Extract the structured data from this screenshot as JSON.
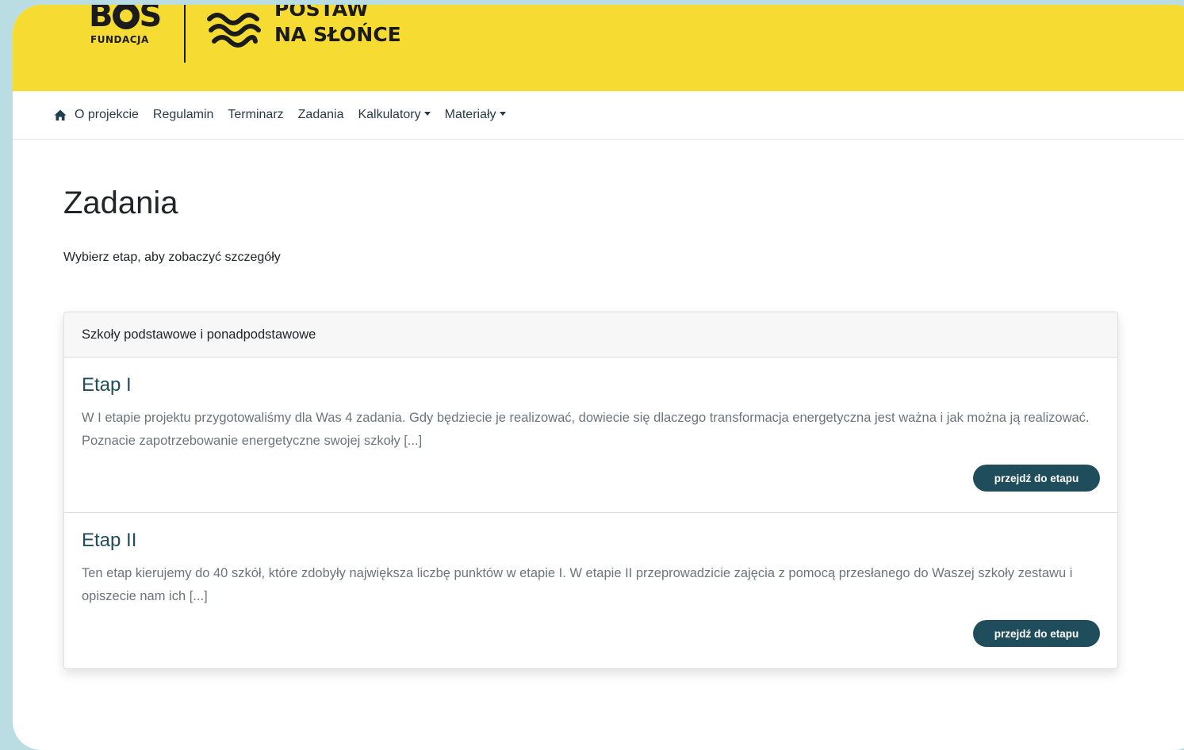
{
  "header": {
    "bos_logo": "B S",
    "bos_logo_sub": "FUNDACJA",
    "project_logo_line1": "POSTAW",
    "project_logo_line2": "NA SŁOŃCE",
    "background_color": "#f6dc32"
  },
  "nav": {
    "home_icon": "home-icon",
    "items": [
      {
        "label": "O projekcie"
      },
      {
        "label": "Regulamin"
      },
      {
        "label": "Terminarz"
      },
      {
        "label": "Zadania"
      },
      {
        "label": "Kalkulatory",
        "dropdown": true
      },
      {
        "label": "Materiały",
        "dropdown": true
      }
    ]
  },
  "page": {
    "title": "Zadania",
    "subtitle": "Wybierz etap, aby zobaczyć szczegóły"
  },
  "card": {
    "header": "Szkoły podstawowe i ponadpodstawowe",
    "stages": [
      {
        "title": "Etap I",
        "description": "W I etapie projektu przygotowaliśmy dla Was 4 zadania. Gdy będziecie je realizować, dowiecie się dlaczego transformacja energetyczna jest ważna i jak można ją realizować. Poznacie zapotrzebowanie energetyczne swojej szkoły [...]",
        "button": "przejdź do etapu"
      },
      {
        "title": "Etap II",
        "description": "Ten etap kierujemy do 40 szkół, które zdobyły największa liczbę punktów w etapie I. W etapie II przeprowadzicie zajęcia z pomocą przesłanego do Waszej szkoły zestawu i opiszecie nam ich [...]",
        "button": "przejdź do etapu"
      }
    ]
  },
  "colors": {
    "accent": "#1f4d5c",
    "page_background": "#b9dde3"
  }
}
